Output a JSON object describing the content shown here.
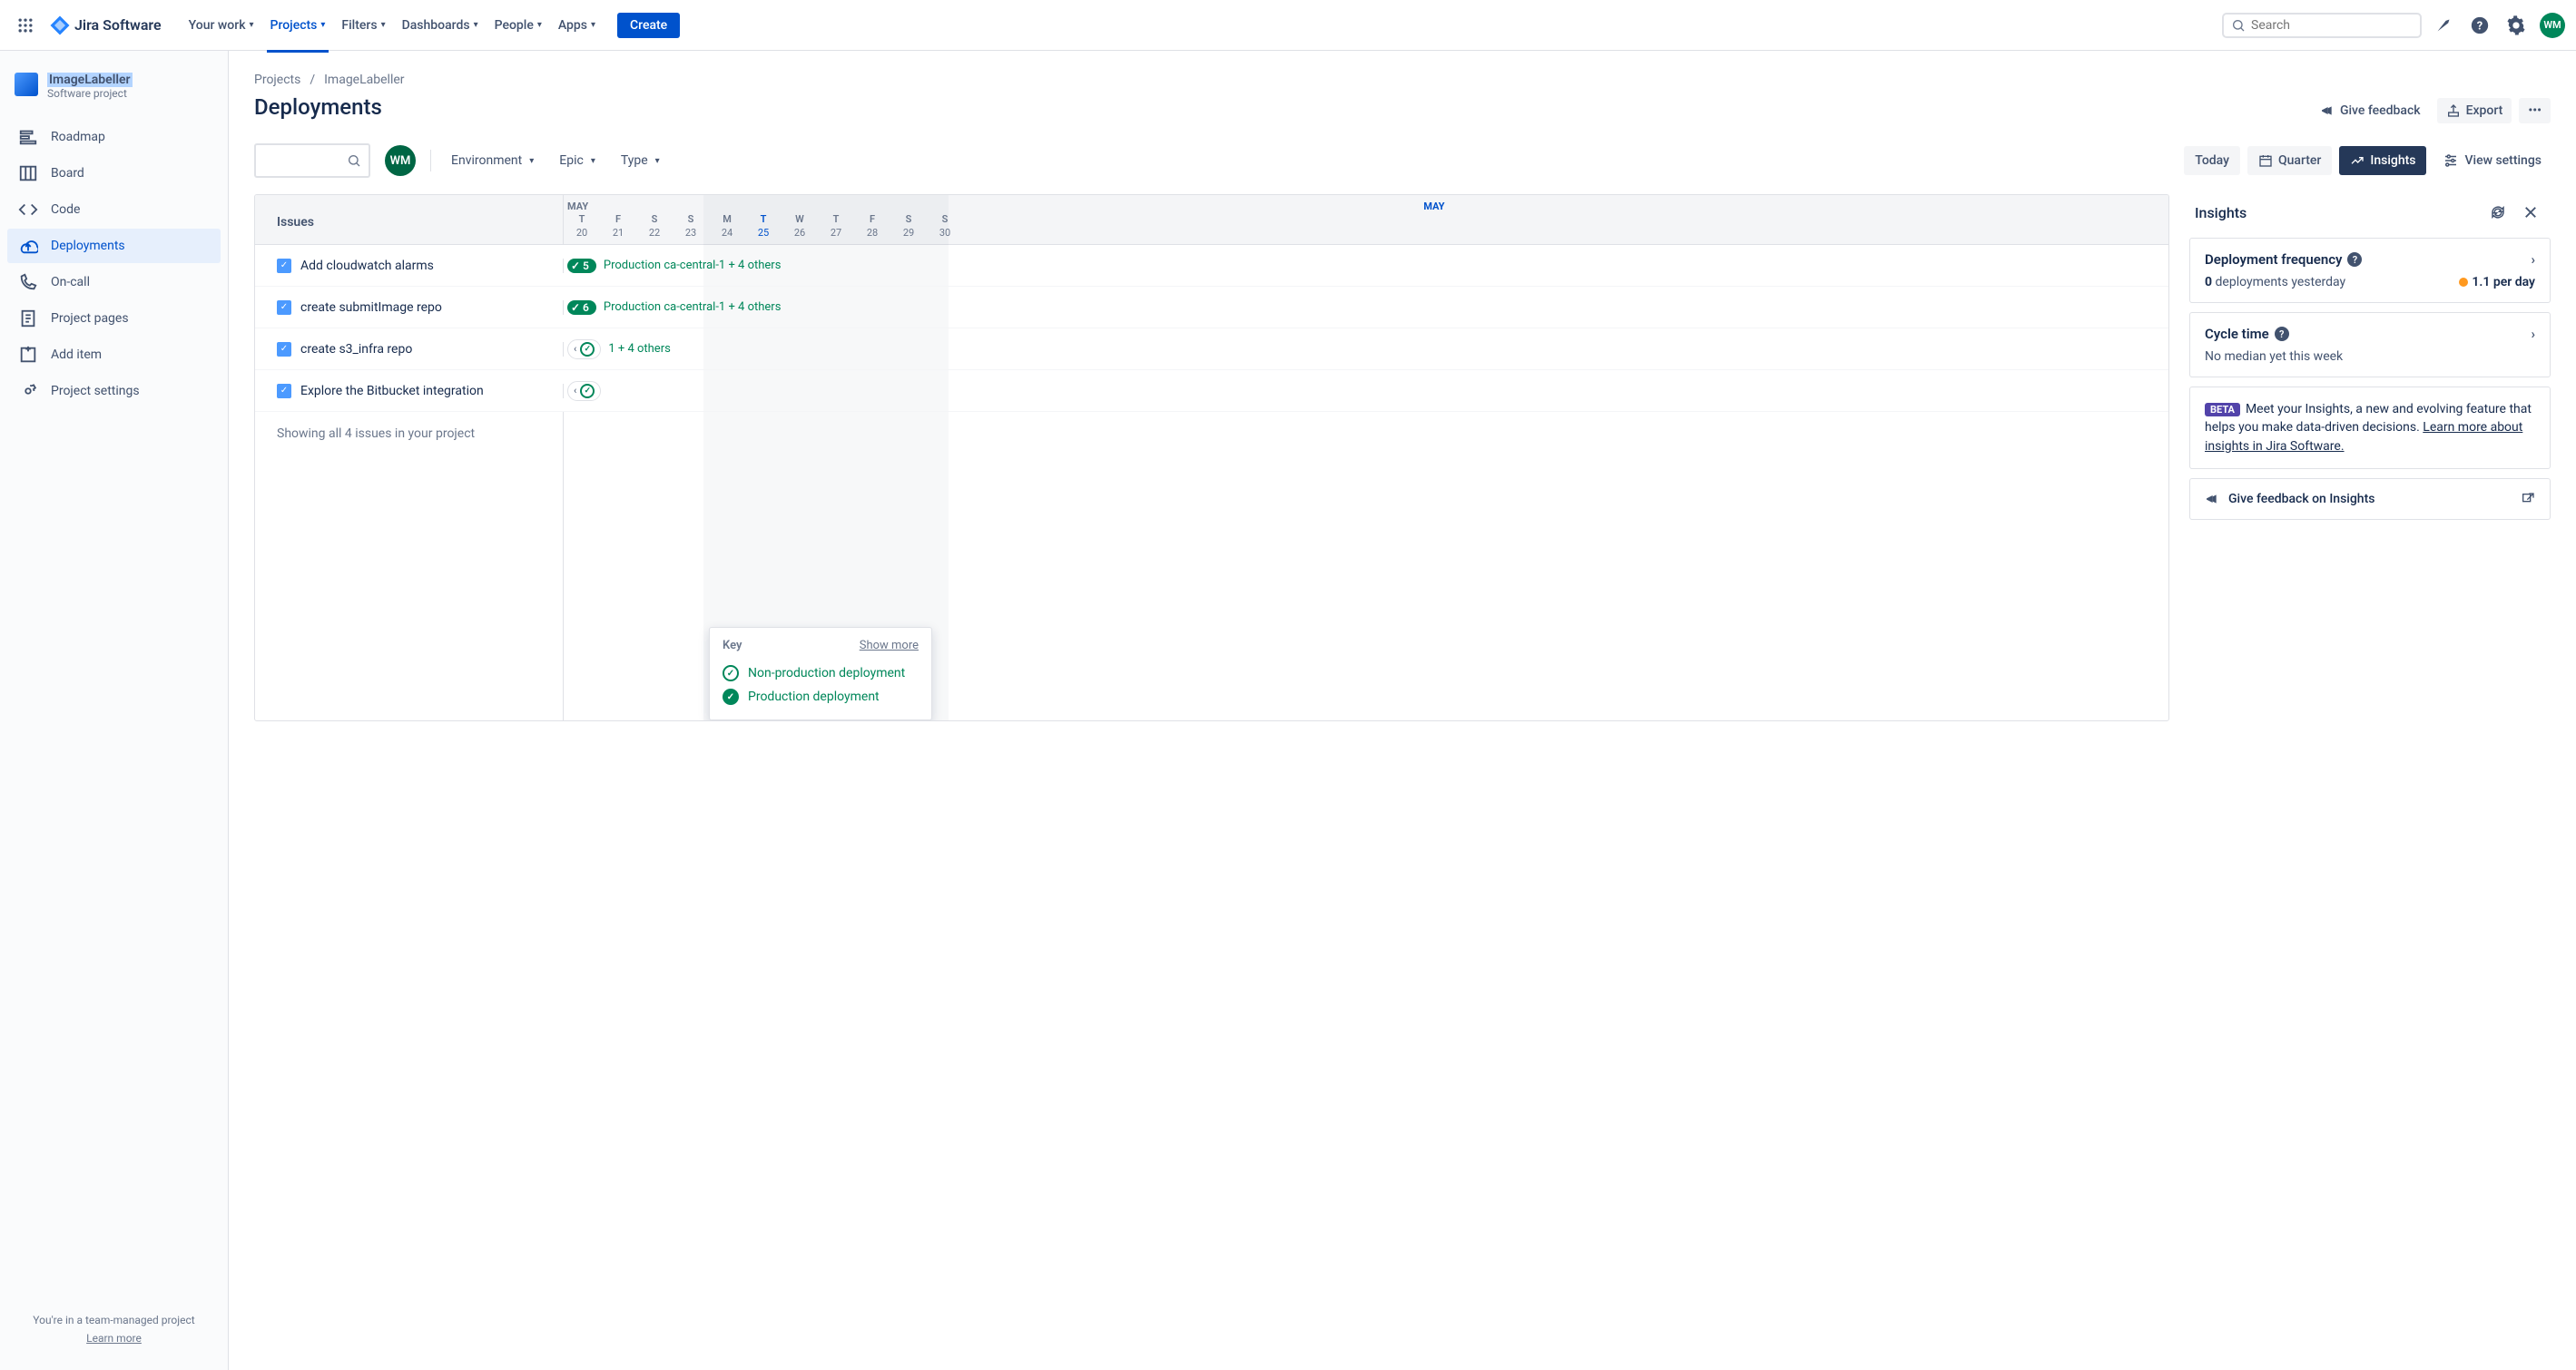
{
  "topnav": {
    "logo": "Jira Software",
    "items": [
      "Your work",
      "Projects",
      "Filters",
      "Dashboards",
      "People",
      "Apps"
    ],
    "active_index": 1,
    "create": "Create",
    "search_placeholder": "Search",
    "avatar": "WM"
  },
  "sidebar": {
    "project_name": "ImageLabeller",
    "project_type": "Software project",
    "items": [
      "Roadmap",
      "Board",
      "Code",
      "Deployments",
      "On-call",
      "Project pages",
      "Add item",
      "Project settings"
    ],
    "active_index": 3,
    "footer_line": "You're in a team-managed project",
    "footer_link": "Learn more"
  },
  "breadcrumbs": [
    "Projects",
    "ImageLabeller"
  ],
  "page_title": "Deployments",
  "page_actions": {
    "feedback": "Give feedback",
    "export": "Export"
  },
  "filters": {
    "environment": "Environment",
    "epic": "Epic",
    "type": "Type",
    "avatar": "WM",
    "today": "Today",
    "quarter": "Quarter",
    "insights": "Insights",
    "view_settings": "View settings"
  },
  "timeline": {
    "issues_header": "Issues",
    "month1": "MAY",
    "month2": "MAY",
    "days": [
      {
        "dow": "T",
        "num": "20"
      },
      {
        "dow": "F",
        "num": "21"
      },
      {
        "dow": "S",
        "num": "22"
      },
      {
        "dow": "S",
        "num": "23"
      },
      {
        "dow": "M",
        "num": "24"
      },
      {
        "dow": "T",
        "num": "25",
        "today": true
      },
      {
        "dow": "W",
        "num": "26"
      },
      {
        "dow": "T",
        "num": "27"
      },
      {
        "dow": "F",
        "num": "28"
      },
      {
        "dow": "S",
        "num": "29"
      },
      {
        "dow": "S",
        "num": "30"
      }
    ],
    "rows": [
      {
        "title": "Add cloudwatch alarms",
        "badge": "5",
        "text": "Production ca-central-1 + 4 others",
        "style": "pill"
      },
      {
        "title": "create submitImage repo",
        "badge": "6",
        "text": "Production ca-central-1 + 4 others",
        "style": "pill"
      },
      {
        "title": "create s3_infra repo",
        "text": "1 + 4 others",
        "style": "chip"
      },
      {
        "title": "Explore the Bitbucket integration",
        "style": "chip-only"
      }
    ],
    "footer": "Showing all 4 issues in your project"
  },
  "key_popup": {
    "title": "Key",
    "more": "Show more",
    "rows": [
      "Non-production deployment",
      "Production deployment"
    ]
  },
  "insights": {
    "title": "Insights",
    "freq_title": "Deployment frequency",
    "freq_count": "0",
    "freq_text": "deployments yesterday",
    "freq_rate": "1.1 per day",
    "cycle_title": "Cycle time",
    "cycle_text": "No median yet this week",
    "beta": "BETA",
    "intro": "Meet your Insights, a new and evolving feature that helps you make data-driven decisions.",
    "intro_link": "Learn more about insights in Jira Software.",
    "feedback": "Give feedback on Insights"
  }
}
